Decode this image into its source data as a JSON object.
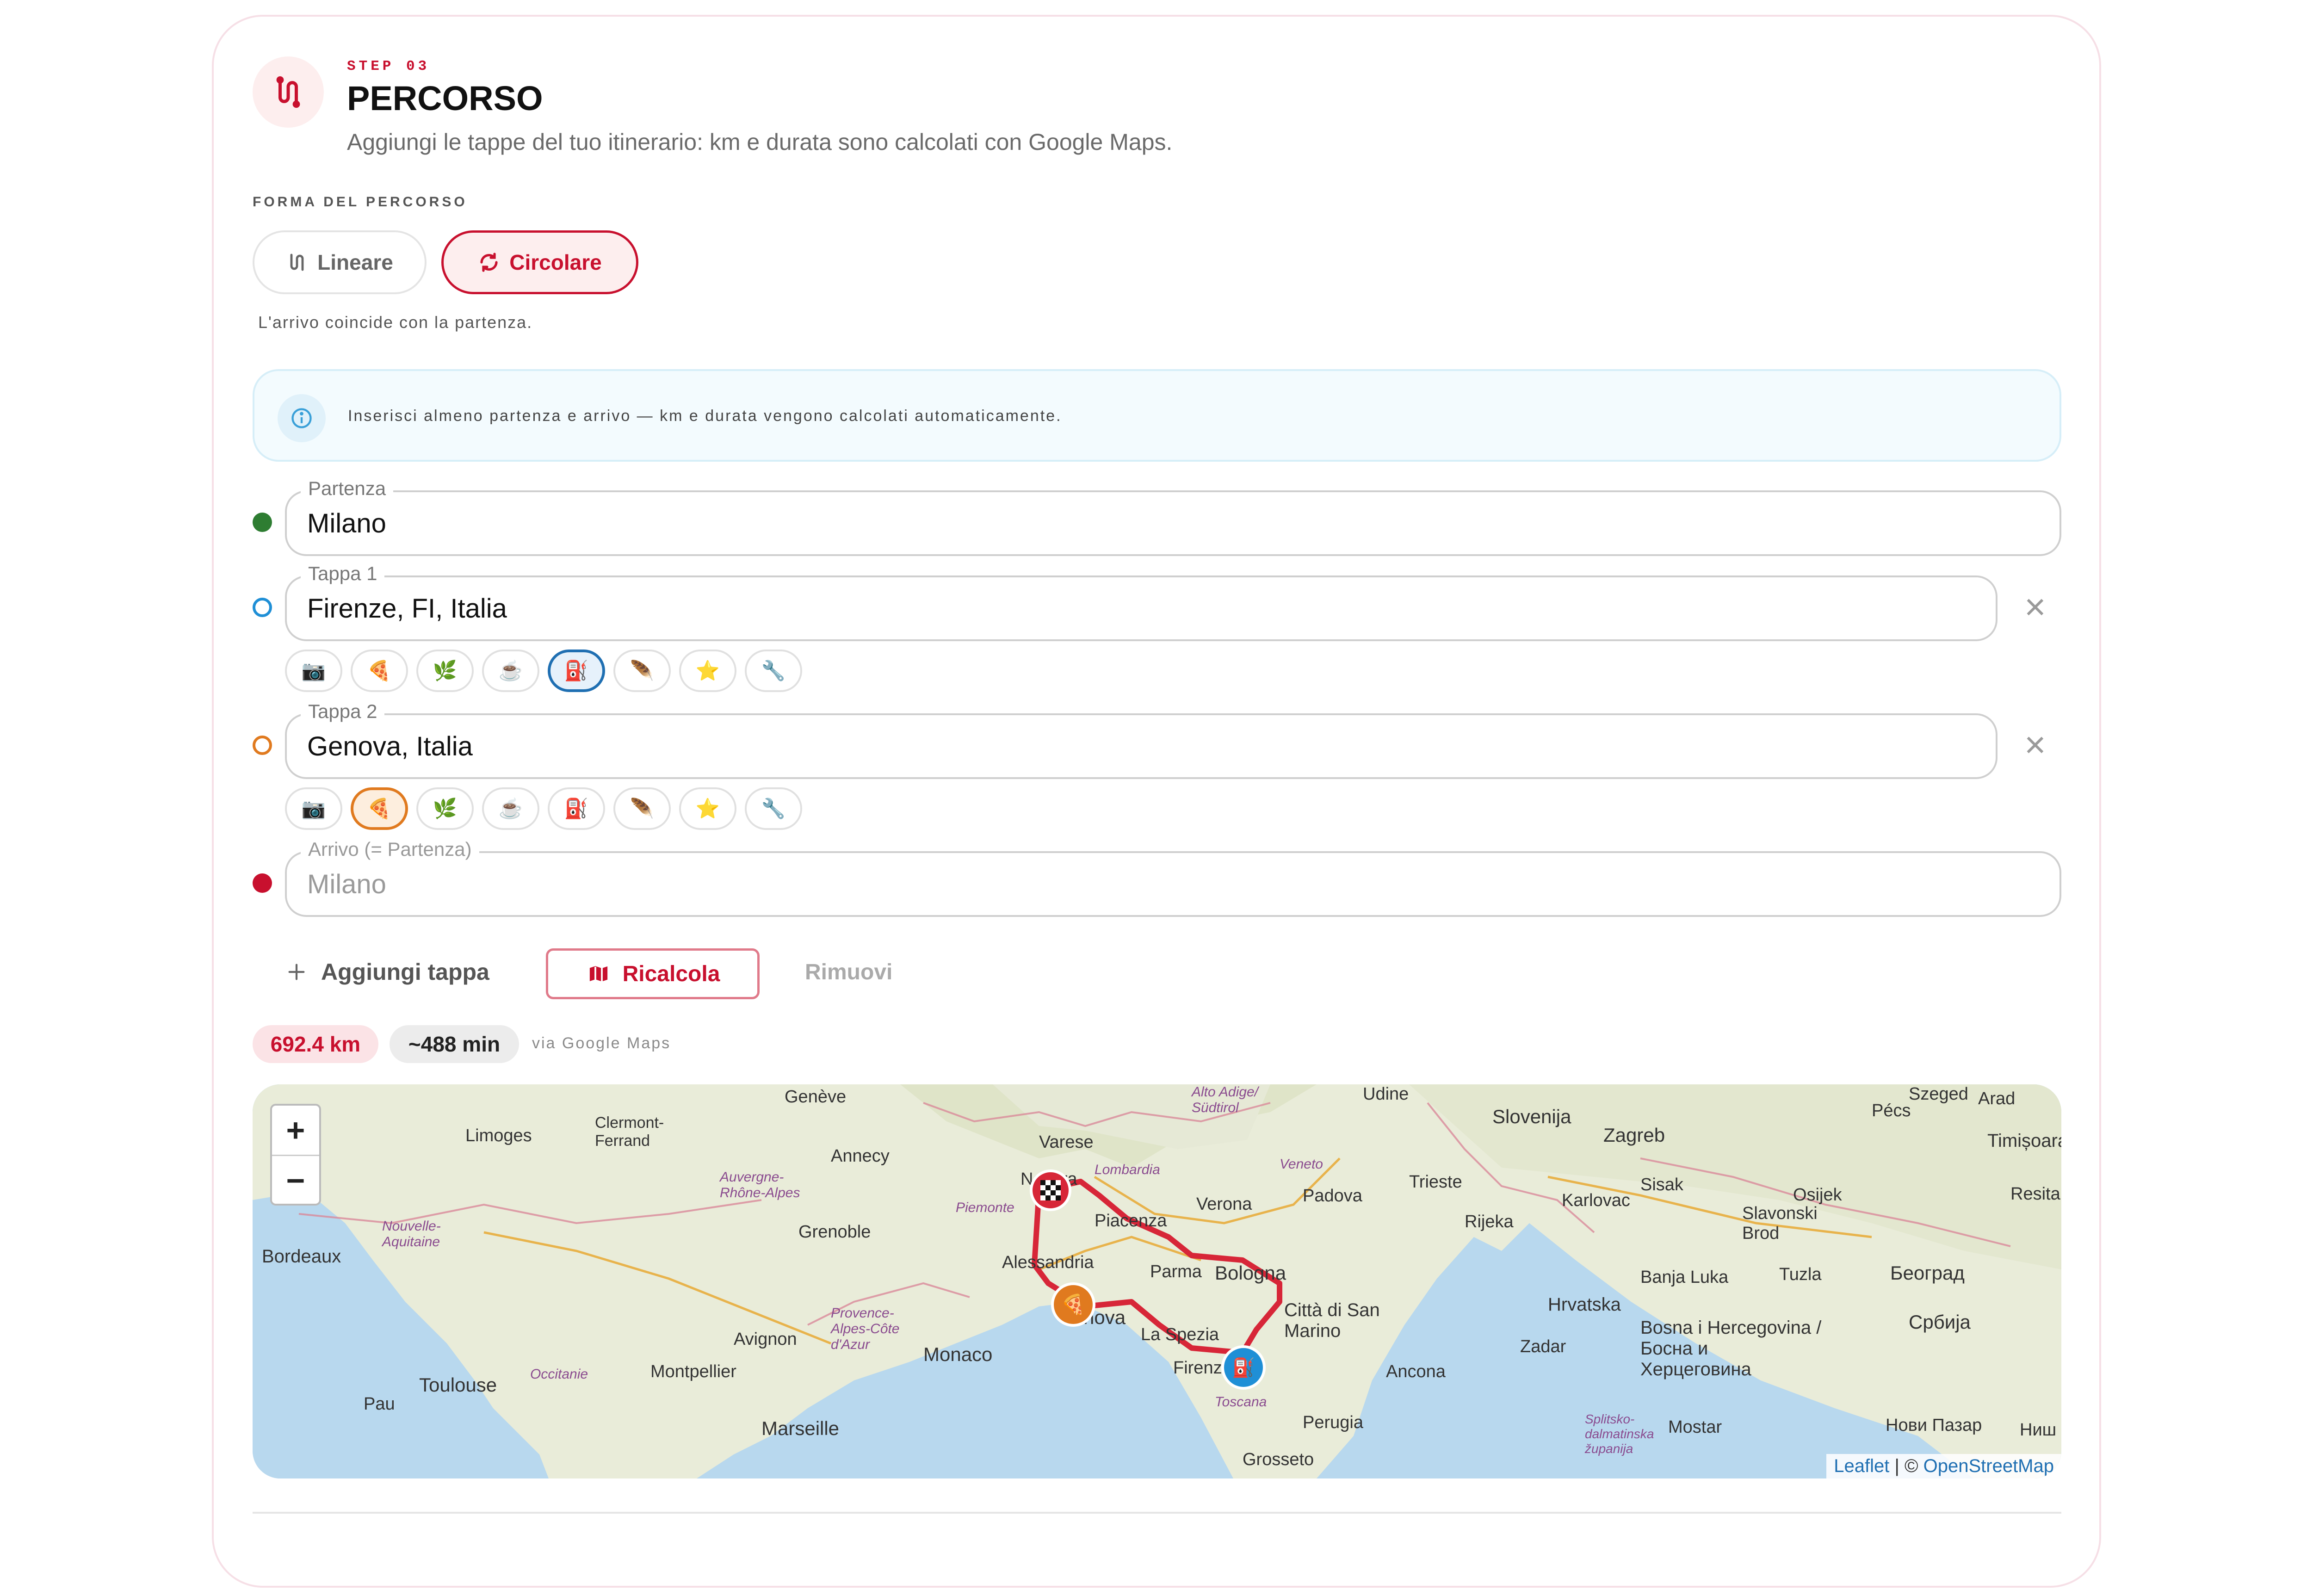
{
  "step": {
    "label": "STEP 03",
    "title": "PERCORSO",
    "subtitle": "Aggiungi le tappe del tuo itinerario: km e durata sono calcolati con Google Maps."
  },
  "shape": {
    "label": "FORMA DEL PERCORSO",
    "options": [
      "Lineare",
      "Circolare"
    ],
    "selected": "Circolare",
    "note": "L'arrivo coincide con la partenza."
  },
  "info": {
    "icon": "info-icon",
    "text": "Inserisci almeno partenza e arrivo — km e durata vengono calcolati automaticamente."
  },
  "stops": {
    "start": {
      "legend": "Partenza",
      "value": "Milano",
      "color": "#2e7d32"
    },
    "stop1": {
      "legend": "Tappa 1",
      "value": "Firenze, FI, Italia",
      "color": "#1f8fd6",
      "selected_category": "fuel"
    },
    "stop2": {
      "legend": "Tappa 2",
      "value": "Genova, Italia",
      "color": "#e07a1f",
      "selected_category": "food"
    },
    "end": {
      "legend": "Arrivo (= Partenza)",
      "placeholder": "Milano",
      "color": "#c8102e"
    }
  },
  "categories": [
    {
      "name": "photo",
      "icon": "📷"
    },
    {
      "name": "food",
      "icon": "🍕"
    },
    {
      "name": "nature",
      "icon": "🌿"
    },
    {
      "name": "coffee",
      "icon": "☕"
    },
    {
      "name": "fuel",
      "icon": "⛽"
    },
    {
      "name": "pass",
      "icon": "🪶"
    },
    {
      "name": "star",
      "icon": "⭐"
    },
    {
      "name": "wrench",
      "icon": "🔧"
    }
  ],
  "actions": {
    "add_stop": "Aggiungi tappa",
    "recalc": "Ricalcola",
    "remove": "Rimuovi"
  },
  "stats": {
    "distance": "692.4 km",
    "duration": "~488 min",
    "source": "via Google Maps"
  },
  "map": {
    "zoom_in": "+",
    "zoom_out": "−",
    "attribution": {
      "leaflet": "Leaflet",
      "sep": " | © ",
      "osm": "OpenStreetMap"
    },
    "labels": [
      "Genève",
      "Limoges",
      "Clermont-Ferrand",
      "Annecy",
      "Auvergne-Rhône-Alpes",
      "Grenoble",
      "Varese",
      "Novara",
      "Lombardia",
      "Piemonte",
      "Piacenza",
      "Alessandria",
      "Parma",
      "Bologna",
      "Verona",
      "Padova",
      "Veneto",
      "Trieste",
      "Slovenija",
      "Zagreb",
      "Rijeka",
      "Karlovac",
      "Hrvatska",
      "Sisak",
      "Slavonski Brod",
      "Osijek",
      "Pécs",
      "Szeged",
      "Arad",
      "Timișoara",
      "Bordeaux",
      "Nouvelle-Aquitaine",
      "Toulouse",
      "Occitanie",
      "Montpellier",
      "Marseille",
      "Avignon",
      "Provence-Alpes-Côte d'Azur",
      "Monaco",
      "Genova",
      "La Spezia",
      "Firenze",
      "Toscana",
      "Città di San Marino",
      "Ancona",
      "Perugia",
      "Grosseto",
      "Zadar",
      "Banja Luka",
      "Tuzla",
      "Bosna i Hercegovina",
      "Београд",
      "Србија",
      "Mostar",
      "Udine",
      "Alto Adige/Südtirol",
      "Pau",
      "Resita",
      "Splitsko-dalmatinska županija",
      "Нови Пазар",
      "Ниш"
    ]
  }
}
